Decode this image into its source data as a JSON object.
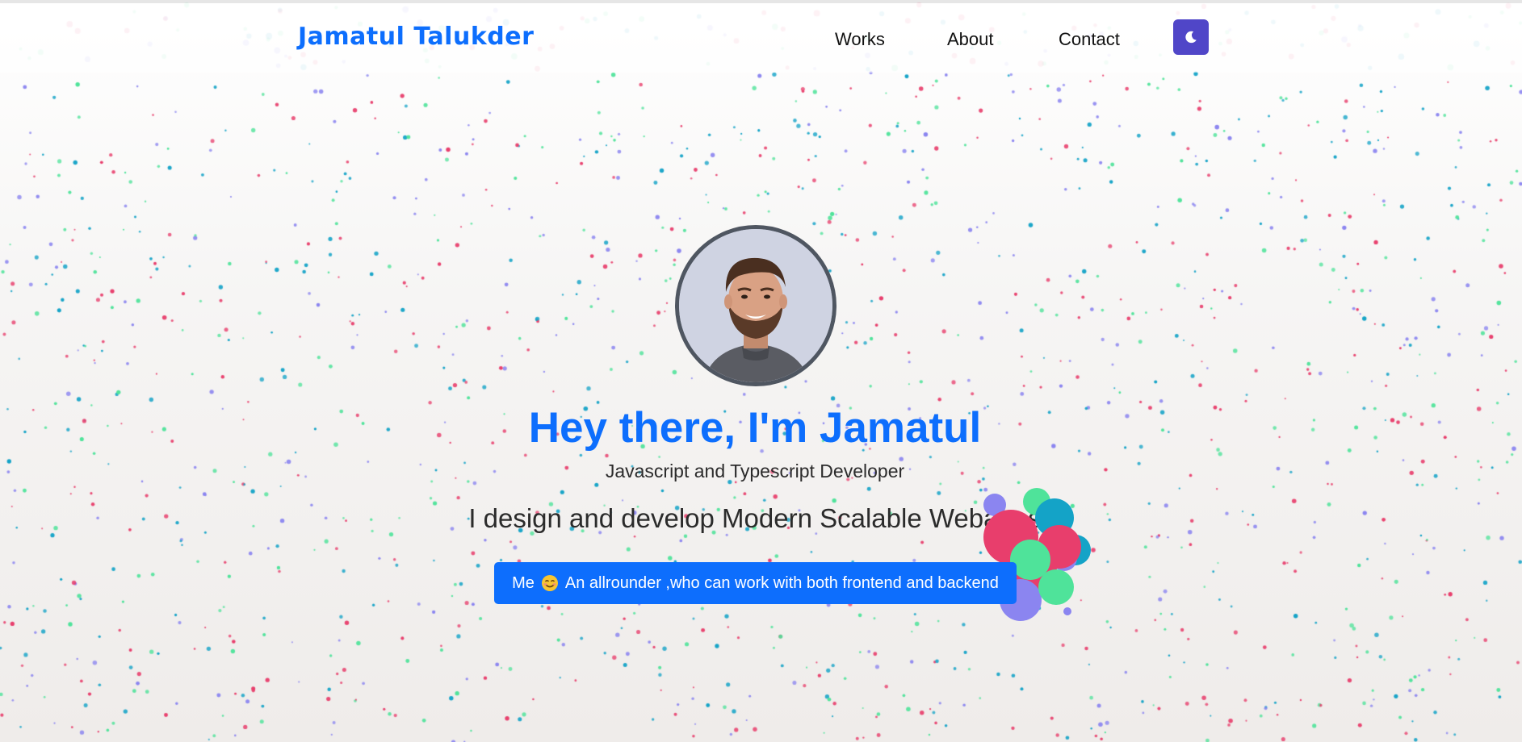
{
  "colors": {
    "brand": "#0d6efd",
    "toggle": "#5046c8",
    "text": "#2b2b2b",
    "particles": [
      "#e83e6c",
      "#14a3c7",
      "#8b85f0",
      "#4fe39a"
    ]
  },
  "header": {
    "brand": "Jamatul Talukder",
    "nav": [
      {
        "label": "Works"
      },
      {
        "label": "About"
      },
      {
        "label": "Contact"
      }
    ],
    "theme_toggle_icon": "moon-icon"
  },
  "hero": {
    "avatar_icon": "profile-photo",
    "title": "Hey there, I'm Jamatul",
    "subtitle": "Javascript and Typescript Developer",
    "tagline": "I design and develop Modern Scalable Webapps",
    "cta": {
      "prefix": "Me",
      "emoji_icon": "smiling-face-icon",
      "text": "An allrounder ,who can work with both frontend and backend"
    }
  }
}
